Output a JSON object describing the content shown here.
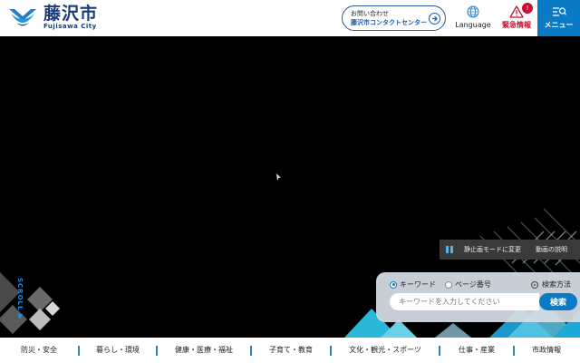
{
  "header": {
    "logo_text_jp": "藤沢市",
    "logo_text_en": "Fujisawa City",
    "contact_line1": "お問い合わせ",
    "contact_line2": "藤沢市コンタクトセンター",
    "language_label": "Language",
    "emergency_label": "緊急情報",
    "emergency_badge": "!",
    "menu_label": "メニュー"
  },
  "hero": {
    "scroll_label": "SCROLL",
    "still_mode_label": "静止画モードに変更",
    "video_desc_label": "動画の説明"
  },
  "search": {
    "radio_keyword": "キーワード",
    "radio_page_number": "ページ番号",
    "how_to_search": "検索方法",
    "placeholder": "キーワードを入力してください",
    "button_label": "検索"
  },
  "nav": {
    "items": [
      "防災・安全",
      "暮らし・環境",
      "健康・医療・福祉",
      "子育て・教育",
      "文化・観光・スポーツ",
      "仕事・産業",
      "市政情報"
    ]
  },
  "colors": {
    "brand_navy": "#1a3a7a",
    "accent_blue": "#0a7ac6",
    "emergency_red": "#c8102e",
    "hero_background": "#000000"
  },
  "icons": [
    "city-emblem-icon",
    "arrow-right-icon",
    "globe-icon",
    "warning-icon",
    "menu-search-icon",
    "pause-icon"
  ]
}
